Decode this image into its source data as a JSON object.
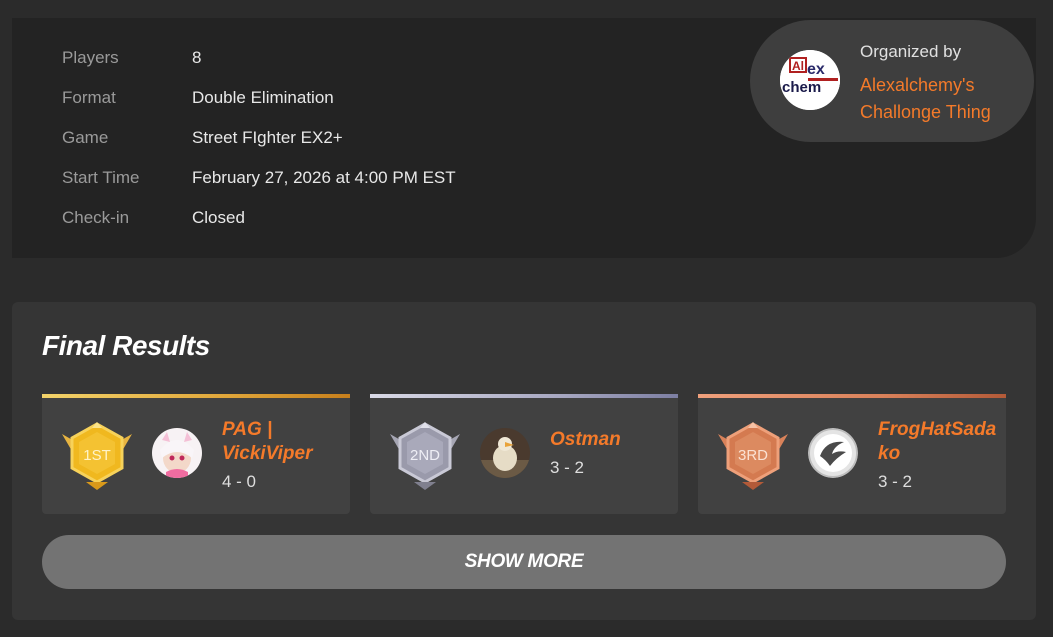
{
  "tournament_info": {
    "rows": [
      {
        "label": "Players",
        "value": "8"
      },
      {
        "label": "Format",
        "value": "Double Elimination"
      },
      {
        "label": "Game",
        "value": "Street FIghter EX2+"
      },
      {
        "label": "Start Time",
        "value": "February 27, 2026 at 4:00 PM EST"
      },
      {
        "label": "Check-in",
        "value": "Closed"
      }
    ]
  },
  "organizer": {
    "title": "Organized by",
    "name": "Alexalchemy's Challonge Thing",
    "avatar_icon": "alexalchemy-logo"
  },
  "results": {
    "title": "Final Results",
    "places": [
      {
        "rank": "1ST",
        "player": "PAG | VickiViper",
        "score": "4 - 0",
        "accent": "#e0a63a",
        "medal": "gold-medal-icon"
      },
      {
        "rank": "2ND",
        "player": "Ostman",
        "score": "3 - 2",
        "accent": "#a9a9c2",
        "medal": "silver-medal-icon"
      },
      {
        "rank": "3RD",
        "player": "FrogHatSadako",
        "score": "3 - 2",
        "accent": "#d9815a",
        "medal": "bronze-medal-icon"
      }
    ],
    "show_more_label": "SHOW MORE"
  },
  "colors": {
    "accent_orange": "#f47a2a",
    "background": "#2b2b2b",
    "card": "#353535"
  }
}
